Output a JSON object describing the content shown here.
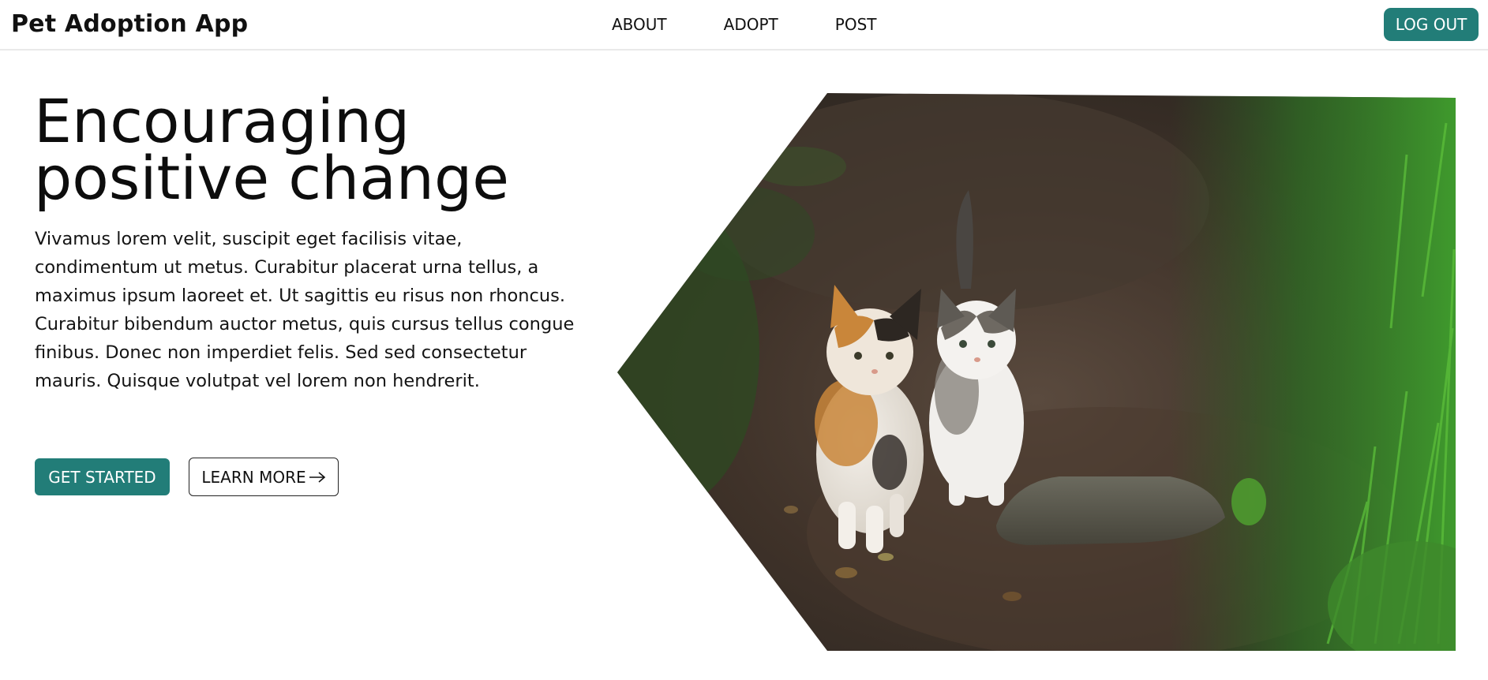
{
  "header": {
    "brand": "Pet Adoption App",
    "nav": [
      {
        "label": "ABOUT"
      },
      {
        "label": "ADOPT"
      },
      {
        "label": "POST"
      }
    ],
    "logout_label": "LOG OUT",
    "accent_color": "#227d78"
  },
  "hero": {
    "title_line1": "Encouraging",
    "title_line2": "positive change",
    "body": "Vivamus lorem velit, suscipit eget facilisis vitae, condimentum ut metus. Curabitur placerat urna tellus, a maximus ipsum laoreet et. Ut sagittis eu risus non rhoncus. Curabitur bibendum auctor metus, quis cursus tellus congue finibus. Donec non imperdiet felis. Sed sed consectetur mauris. Quisque volutpat vel lorem non hendrerit.",
    "primary_button": "GET STARTED",
    "secondary_button": "LEARN MORE",
    "secondary_icon": "arrow-right-icon",
    "image_subject": "two kittens walking on a forest path"
  }
}
